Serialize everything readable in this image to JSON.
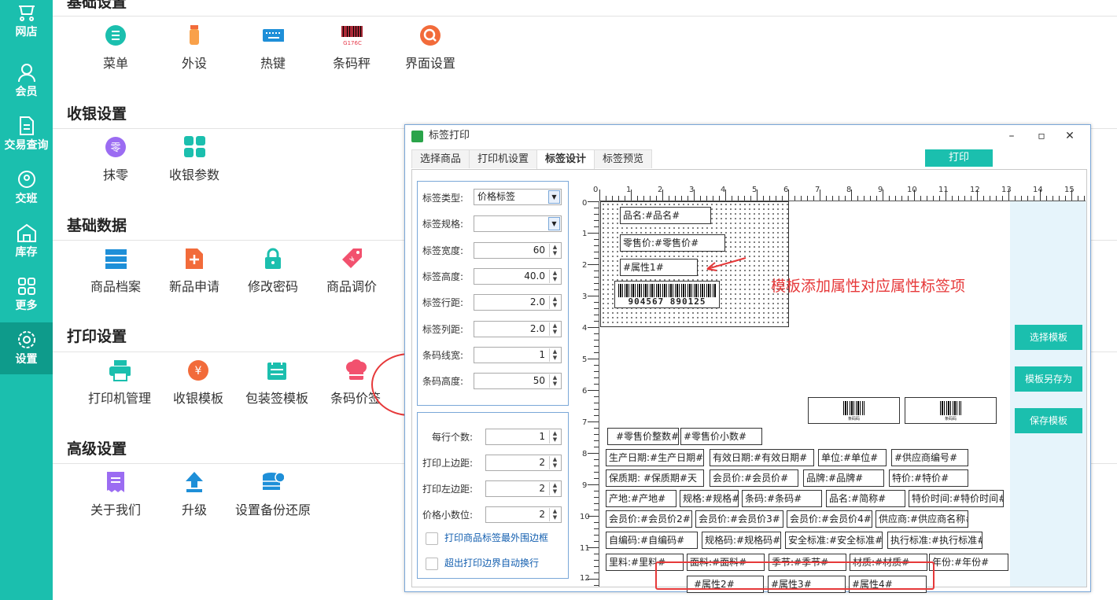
{
  "sidebar": {
    "items": [
      {
        "label": "网店",
        "icon": "shop-icon"
      },
      {
        "label": "会员",
        "icon": "member-icon"
      },
      {
        "label": "交易查询",
        "icon": "document-icon"
      },
      {
        "label": "交班",
        "icon": "shift-icon"
      },
      {
        "label": "库存",
        "icon": "warehouse-icon"
      },
      {
        "label": "更多",
        "icon": "grid-icon"
      },
      {
        "label": "设置",
        "icon": "gear-icon"
      }
    ]
  },
  "sections": {
    "basic": {
      "title": "基础设置",
      "items": [
        "菜单",
        "外设",
        "热键",
        "条码秤",
        "界面设置"
      ],
      "scale_icon_text": "G176C"
    },
    "cashier": {
      "title": "收银设置",
      "items": [
        "抹零",
        "收银参数"
      ],
      "round_icon_text": "零"
    },
    "data": {
      "title": "基础数据",
      "items": [
        "商品档案",
        "新品申请",
        "修改密码",
        "商品调价"
      ],
      "price_icon_text": "¥"
    },
    "print": {
      "title": "打印设置",
      "items": [
        "打印机管理",
        "收银模板",
        "包装签模板",
        "条码价签"
      ],
      "cashier_icon_text": "¥"
    },
    "advanced": {
      "title": "高级设置",
      "items": [
        "关于我们",
        "升级",
        "设置备份还原"
      ]
    }
  },
  "dialog": {
    "title": "标签打印",
    "tabs": [
      "选择商品",
      "打印机设置",
      "标签设计",
      "标签预览"
    ],
    "print_button": "打印",
    "fields": [
      {
        "label": "标签类型:",
        "value": "价格标签"
      },
      {
        "label": "标签规格:",
        "value": ""
      },
      {
        "label": "标签宽度:",
        "value": "60"
      },
      {
        "label": "标签高度:",
        "value": "40.0"
      },
      {
        "label": "标签行距:",
        "value": "2.0"
      },
      {
        "label": "标签列距:",
        "value": "2.0"
      },
      {
        "label": "条码线宽:",
        "value": "1"
      },
      {
        "label": "条码高度:",
        "value": "50"
      }
    ],
    "fields2": [
      {
        "label": "每行个数:",
        "value": "1"
      },
      {
        "label": "打印上边距:",
        "value": "2"
      },
      {
        "label": "打印左边距:",
        "value": "2"
      },
      {
        "label": "价格小数位:",
        "value": "2"
      }
    ],
    "checks": [
      "打印商品标签最外围边框",
      "超出打印边界自动换行"
    ],
    "side_buttons": [
      "选择模板",
      "模板另存为",
      "保存模板"
    ],
    "ruler_top": [
      "0",
      "1",
      "2",
      "3",
      "4",
      "5",
      "6",
      "7",
      "8",
      "9",
      "10",
      "11",
      "12",
      "13",
      "14",
      "15"
    ],
    "ruler_left": [
      "0",
      "1",
      "2",
      "3",
      "4",
      "5",
      "6",
      "7",
      "8",
      "9",
      "10",
      "11",
      "12"
    ],
    "barcode_number": "904567  890125",
    "label_items_top": [
      "品名:#品名#",
      "零售价:#零售价#",
      "#属性1#"
    ],
    "label_fields": [
      "#零售价整数#",
      "#零售价小数#",
      "生产日期:#生产日期#",
      "有效日期:#有效日期#",
      "单位:#单位#",
      "#供应商编号#",
      "保质期: #保质期#天",
      "会员价:#会员价#",
      "品牌:#品牌#",
      "特价:#特价#",
      "产地:#产地#",
      "规格:#规格#",
      "条码:#条码#",
      "品名:#简称#",
      "特价时间:#特价时间#",
      "会员价:#会员价2#",
      "会员价:#会员价3#",
      "会员价:#会员价4#",
      "供应商:#供应商名称#",
      "自编码:#自编码#",
      "规格码:#规格码#",
      "安全标准:#安全标准#",
      "执行标准:#执行标准#",
      "里料:#里料#",
      "面料:#面料#",
      "季节:#季节#",
      "材质:#材质#",
      "年份:#年份#",
      "#属性2#",
      "#属性3#",
      "#属性4#"
    ],
    "barcode_captions": [
      "条码码",
      "条码码"
    ],
    "annotation": "模板添加属性对应属性标签项"
  },
  "colors": {
    "accent": "#1bbfae",
    "highlight": "#e6393a"
  }
}
